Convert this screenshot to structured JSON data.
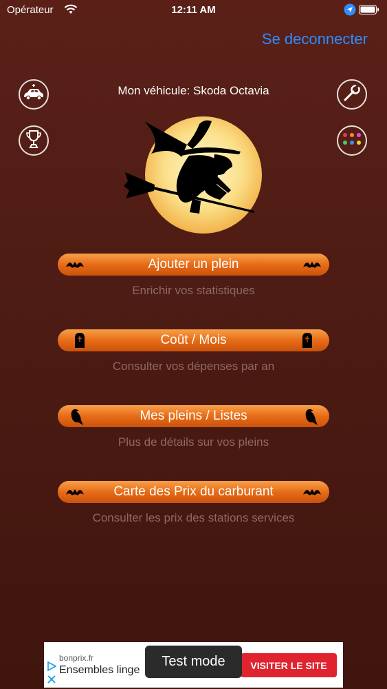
{
  "status_bar": {
    "carrier": "Opérateur",
    "time": "12:11 AM"
  },
  "header": {
    "logout_label": "Se deconnecter",
    "vehicle_label": "Mon véhicule: Skoda Octavia"
  },
  "icons": {
    "add_vehicle": "car-plus-icon",
    "settings": "wrench-icon",
    "trophy": "trophy-icon",
    "themes": "palette-icon",
    "hero": "witch-moon-illustration"
  },
  "menu": [
    {
      "label": "Ajouter un plein",
      "subtitle": "Enrichir vos statistiques",
      "deco": "bat-icon"
    },
    {
      "label": "Coût / Mois",
      "subtitle": "Consulter vos dépenses par an",
      "deco": "tombstone-icon"
    },
    {
      "label": "Mes pleins / Listes",
      "subtitle": "Plus de détails sur vos pleins",
      "deco": "crow-icon"
    },
    {
      "label": "Carte des Prix du carburant",
      "subtitle": "Consulter les prix des stations services",
      "deco": "bat-icon"
    }
  ],
  "ad": {
    "domain": "bonprix.fr",
    "title": "Ensembles linge",
    "cta": "VISITER LE SITE"
  },
  "toast": {
    "text": "Test mode"
  },
  "colors": {
    "accent": "#2f8cff",
    "button_orange": "#e86c17",
    "background": "#4e1c14",
    "ad_cta": "#e0242f"
  }
}
